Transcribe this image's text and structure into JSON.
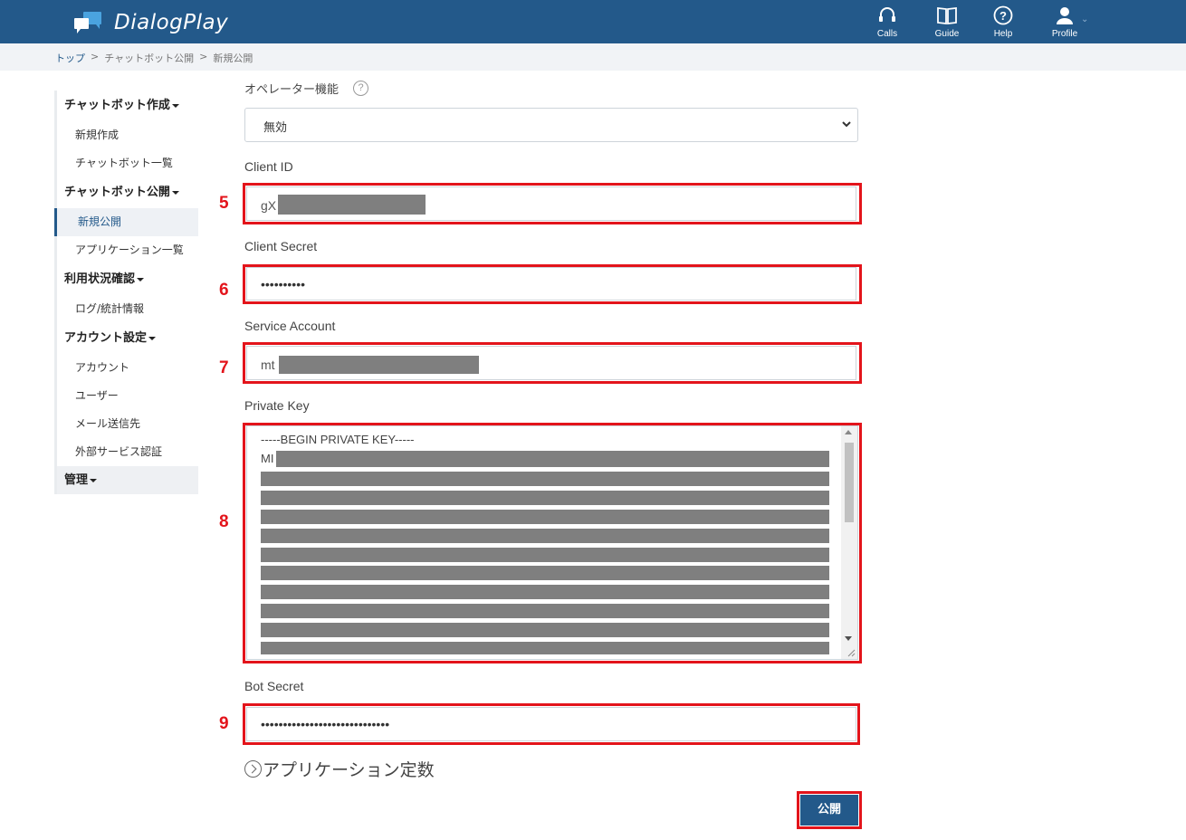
{
  "app": {
    "name": "DialogPlay"
  },
  "header": {
    "nav": [
      {
        "label": "Calls",
        "icon": "headset-icon"
      },
      {
        "label": "Guide",
        "icon": "book-icon"
      },
      {
        "label": "Help",
        "icon": "help-icon"
      },
      {
        "label": "Profile",
        "icon": "user-icon"
      }
    ]
  },
  "breadcrumb": [
    "トップ",
    "チャットボット公開",
    "新規公開"
  ],
  "breadcrumb_sep": ">",
  "sidebar": {
    "sections": [
      {
        "title": "チャットボット作成",
        "items": [
          "新規作成",
          "チャットボット一覧"
        ]
      },
      {
        "title": "チャットボット公開",
        "items": [
          "新規公開",
          "アプリケーション一覧"
        ]
      },
      {
        "title": "利用状況確認",
        "items": [
          "ログ/統計情報"
        ]
      },
      {
        "title": "アカウント設定",
        "items": [
          "アカウント",
          "ユーザー",
          "メール送信先",
          "外部サービス認証"
        ]
      }
    ],
    "admin": "管理",
    "active_item": "新規公開"
  },
  "form": {
    "operator": {
      "label": "オペレーター機能",
      "value": "無効"
    },
    "client_id": {
      "label": "Client ID",
      "value": "gX"
    },
    "client_secret": {
      "label": "Client Secret",
      "value": "••••••••••"
    },
    "service_account": {
      "label": "Service Account",
      "value": "mt"
    },
    "private_key": {
      "label": "Private Key",
      "line1": "-----BEGIN PRIVATE KEY-----",
      "line2": "MI"
    },
    "bot_secret": {
      "label": "Bot Secret",
      "value": "•••••••••••••••••••••••••••••"
    },
    "app_constants": "アプリケーション定数",
    "publish_button": "公開"
  },
  "annotations": [
    "5",
    "6",
    "7",
    "8",
    "9"
  ],
  "colors": {
    "header": "#23598a",
    "highlight": "#e3141b",
    "redaction": "#7f7f7f"
  }
}
